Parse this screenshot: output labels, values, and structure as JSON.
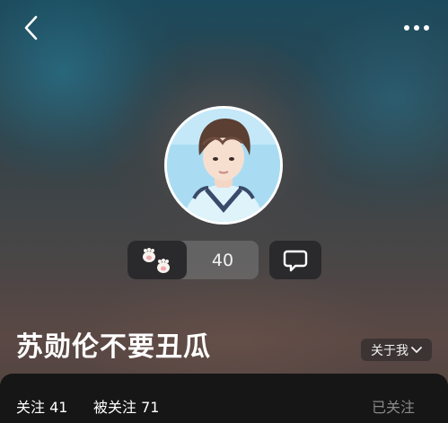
{
  "profile": {
    "username": "苏勋伦不要丑瓜",
    "like_count": "40"
  },
  "about": {
    "label": "关于我"
  },
  "stats": {
    "following_label": "关注",
    "following_count": "41",
    "followers_label": "被关注",
    "followers_count": "71"
  },
  "follow": {
    "state_label": "已关注"
  },
  "icons": {
    "back": "chevron-left-icon",
    "more": "more-dots-icon",
    "paw": "paw-icon",
    "message": "message-icon",
    "about_chevron": "chevron-down-icon"
  },
  "colors": {
    "panel": "#161616",
    "button_dark": "#2a2a2c",
    "muted_text": "#8a8a8a"
  }
}
